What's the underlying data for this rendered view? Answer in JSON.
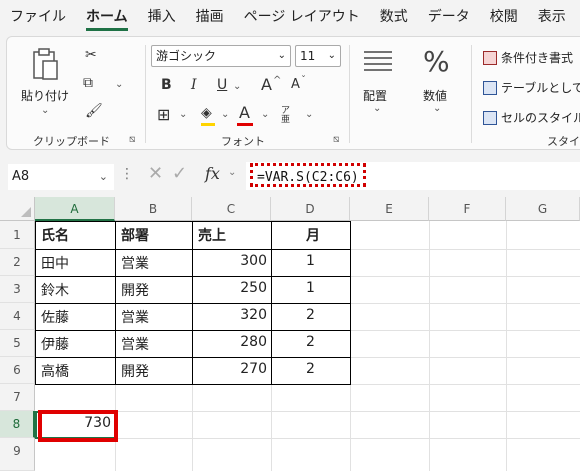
{
  "menu": {
    "tabs": [
      "ファイル",
      "ホーム",
      "挿入",
      "描画",
      "ページ レイアウト",
      "数式",
      "データ",
      "校閲",
      "表示"
    ],
    "active_index": 1
  },
  "ribbon": {
    "clipboard": {
      "paste_label": "貼り付け",
      "group_label": "クリップボード"
    },
    "font": {
      "font_name": "游ゴシック",
      "font_size": "11",
      "bold": "B",
      "italic": "I",
      "underline": "U",
      "grow": "A",
      "shrink": "A",
      "font_color": "A",
      "furigana": "ア亜",
      "group_label": "フォント"
    },
    "alignment": {
      "label": "配置"
    },
    "number": {
      "symbol": "%",
      "label": "数値"
    },
    "styles": {
      "items": [
        "条件付き書式",
        "テーブルとして",
        "セルのスタイル"
      ],
      "group_label": "スタイ"
    }
  },
  "formula_bar": {
    "name_box": "A8",
    "fx": "fx",
    "formula": "=VAR.S(C2:C6)"
  },
  "grid": {
    "columns": [
      "A",
      "B",
      "C",
      "D",
      "E",
      "F",
      "G"
    ],
    "rows": [
      "1",
      "2",
      "3",
      "4",
      "5",
      "6",
      "7",
      "8",
      "9"
    ],
    "selected_column": "A",
    "selected_row": "8",
    "headers": [
      "氏名",
      "部署",
      "売上",
      "月"
    ],
    "data": [
      [
        "田中",
        "営業",
        "300",
        "1"
      ],
      [
        "鈴木",
        "開発",
        "250",
        "1"
      ],
      [
        "佐藤",
        "営業",
        "320",
        "2"
      ],
      [
        "伊藤",
        "営業",
        "280",
        "2"
      ],
      [
        "高橋",
        "開発",
        "270",
        "2"
      ]
    ],
    "result": "730",
    "colors": {
      "accent": "#217346",
      "highlight": "#e00000"
    }
  }
}
